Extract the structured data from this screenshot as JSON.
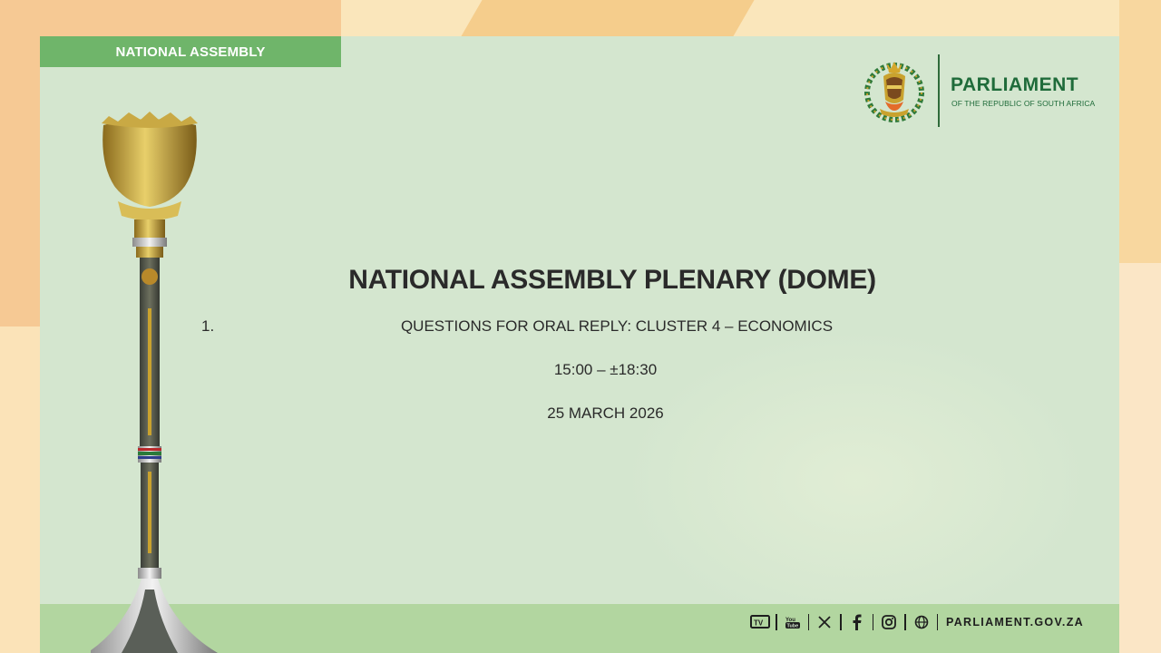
{
  "section_tag": "NATIONAL ASSEMBLY",
  "logo": {
    "title": "PARLIAMENT",
    "subtitle": "OF THE REPUBLIC OF SOUTH AFRICA",
    "icon": "parliament-crest-icon"
  },
  "main_title": "NATIONAL ASSEMBLY PLENARY (DOME)",
  "agenda": {
    "number": "1.",
    "item": "QUESTIONS FOR ORAL REPLY: CLUSTER 4 – ECONOMICS",
    "time": "15:00 – ±18:30",
    "date": "25 MARCH 2026"
  },
  "footer": {
    "social_icons": [
      "tv-icon",
      "youtube-icon",
      "x-icon",
      "facebook-icon",
      "instagram-icon",
      "web-icon"
    ],
    "website": "PARLIAMENT.GOV.ZA"
  },
  "colors": {
    "panel": "#d4e6cf",
    "tag": "#6fb56a",
    "brand_green": "#1f6b3a",
    "warm_bg": "#f6c994"
  }
}
